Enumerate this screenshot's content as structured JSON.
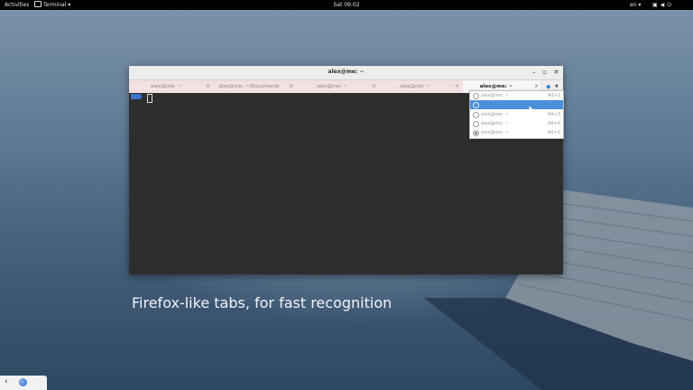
{
  "topbar": {
    "activities": "Activities",
    "app_menu": "Terminal ▾",
    "clock": "Sat 09:02",
    "language": "en ▾",
    "tray_icons": [
      "window-icon",
      "volume-icon",
      "power-icon"
    ]
  },
  "window": {
    "title": "alex@me: ~",
    "controls": [
      "minimize",
      "maximize",
      "close"
    ],
    "tabs": [
      {
        "label": "alex@me: ~",
        "active": false
      },
      {
        "label": "alex@me: ~/Documents",
        "active": false
      },
      {
        "label": "alex@me: ~",
        "active": false
      },
      {
        "label": "alex@me: ~",
        "active": false
      },
      {
        "label": "alex@me: ~",
        "active": true
      }
    ],
    "tab_close": "×"
  },
  "tab_menu": {
    "items": [
      {
        "label": "alex@me: ~",
        "shortcut": "Alt+1",
        "checked": false,
        "highlighted": false
      },
      {
        "label": "",
        "shortcut": "",
        "checked": false,
        "highlighted": true
      },
      {
        "label": "alex@me: ~",
        "shortcut": "Alt+3",
        "checked": false,
        "highlighted": false
      },
      {
        "label": "alex@me: ~",
        "shortcut": "Alt+4",
        "checked": false,
        "highlighted": false
      },
      {
        "label": "alex@me: ~",
        "shortcut": "Alt+5",
        "checked": true,
        "highlighted": false
      }
    ]
  },
  "caption": "Firefox-like tabs, for fast recognition",
  "colors": {
    "accent": "#4a90d9",
    "terminal_bg": "#2d2e2e",
    "tabbar_bg": "#f3e0e0"
  }
}
